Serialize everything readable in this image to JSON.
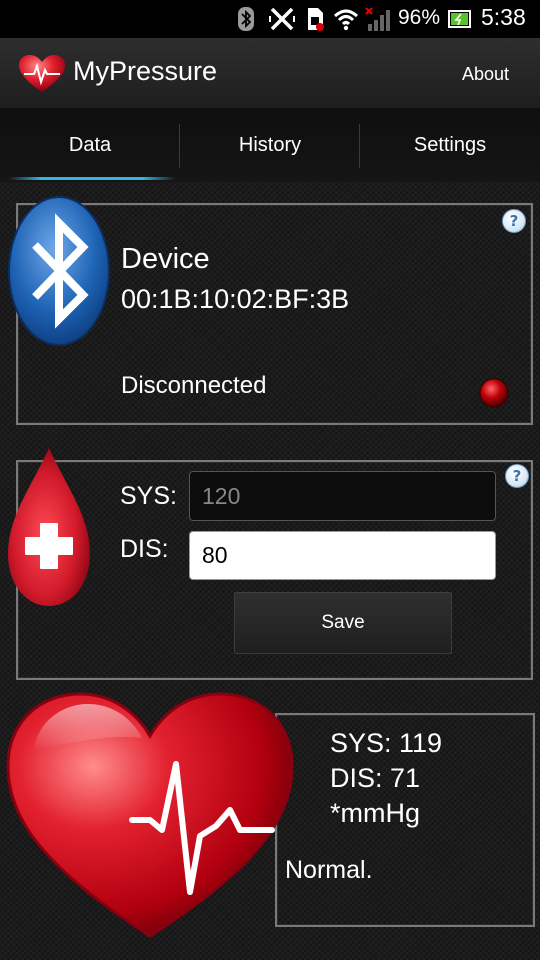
{
  "status_bar": {
    "battery_percent": "96%",
    "time": "5:38",
    "icons": [
      "bluetooth-icon",
      "vibrate-icon",
      "sim-icon",
      "wifi-icon",
      "signal-icon",
      "battery-icon"
    ]
  },
  "action_bar": {
    "title": "MyPressure",
    "about_label": "About"
  },
  "tabs": [
    {
      "label": "Data",
      "selected": true
    },
    {
      "label": "History",
      "selected": false
    },
    {
      "label": "Settings",
      "selected": false
    }
  ],
  "device_panel": {
    "title": "Device",
    "address": "00:1B:10:02:BF:3B",
    "status": "Disconnected",
    "help": "?"
  },
  "input_panel": {
    "sys_label": "SYS:",
    "sys_placeholder": "120",
    "dis_label": "DIS:",
    "dis_value": "80",
    "save_label": "Save",
    "help": "?"
  },
  "result_panel": {
    "sys": "SYS: 119",
    "dis": "DIS: 71",
    "unit": "*mmHg",
    "classification": "Normal."
  },
  "colors": {
    "accent": "#33b5e5",
    "status_led": "#c0000b",
    "heart_red": "#d11a2a",
    "bluetooth_blue": "#1e63b5"
  }
}
